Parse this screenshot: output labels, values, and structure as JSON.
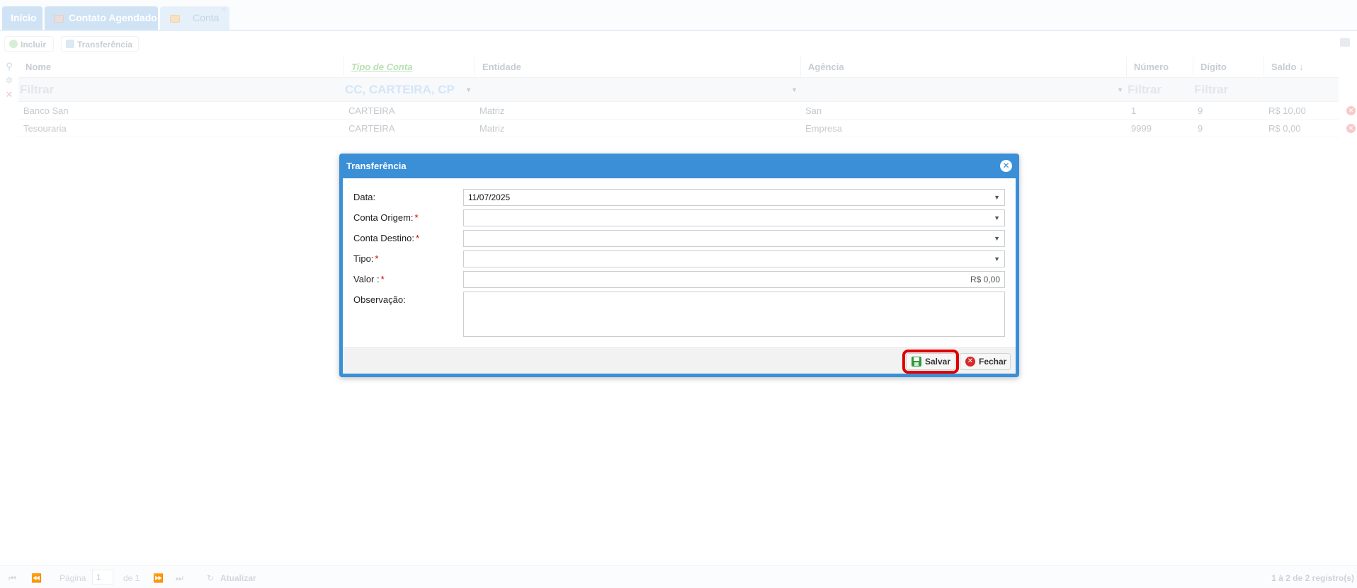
{
  "tabs": [
    {
      "label": "Início"
    },
    {
      "label": "Contato Agendado"
    },
    {
      "label": "Conta"
    }
  ],
  "toolbar": {
    "incluir": "Incluir",
    "transferencia": "Transferência"
  },
  "grid": {
    "columns": [
      "Nome",
      "Tipo de Conta",
      "Entidade",
      "Agência",
      "Número",
      "Dígito",
      "Saldo ↓"
    ],
    "filters": {
      "nome": "Filtrar",
      "tipo": "CC, CARTEIRA, CP",
      "numero": "Filtrar",
      "digito": "Filtrar"
    },
    "rows": [
      {
        "nome": "Banco San",
        "tipo": "CARTEIRA",
        "entidade": "Matriz",
        "agencia": "San",
        "numero": "1",
        "digito": "9",
        "saldo": "R$ 10,00"
      },
      {
        "nome": "Tesouraria",
        "tipo": "CARTEIRA",
        "entidade": "Matriz",
        "agencia": "Empresa",
        "numero": "9999",
        "digito": "9",
        "saldo": "R$ 0,00"
      }
    ]
  },
  "pager": {
    "pagina": "Página",
    "page": "1",
    "of": "de 1",
    "atualizar": "Atualizar",
    "registros": "1 à 2 de 2 registro(s)"
  },
  "dialog": {
    "title": "Transferência",
    "fields": {
      "data_label": "Data:",
      "data_value": "11/07/2025",
      "origem_label": "Conta Origem:",
      "destino_label": "Conta Destino:",
      "tipo_label": "Tipo:",
      "valor_label": "Valor :",
      "valor_value": "R$ 0,00",
      "obs_label": "Observação:"
    },
    "salvar": "Salvar",
    "fechar": "Fechar"
  }
}
